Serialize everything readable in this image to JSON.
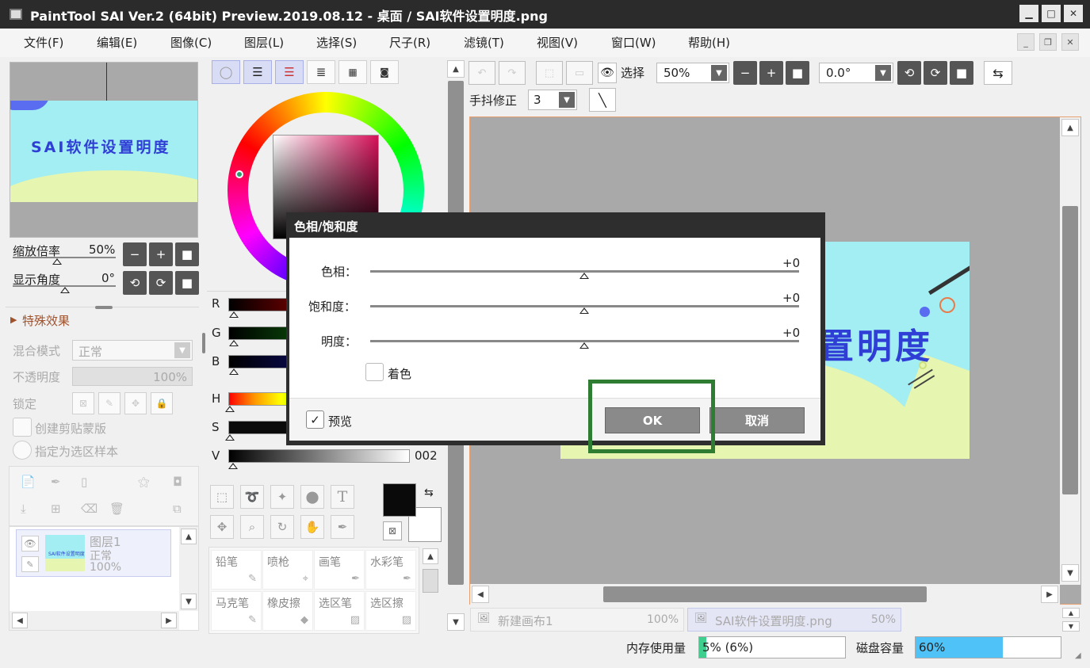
{
  "window": {
    "title": "PaintTool SAI Ver.2 (64bit) Preview.2019.08.12 - 桌面 / SAI软件设置明度.png"
  },
  "menu": [
    "文件(F)",
    "编辑(E)",
    "图像(C)",
    "图层(L)",
    "选择(S)",
    "尺子(R)",
    "滤镜(T)",
    "视图(V)",
    "窗口(W)",
    "帮助(H)"
  ],
  "navigator": {
    "preview_text": "SAI软件设置明度",
    "zoom_label": "缩放倍率",
    "zoom_value": "50%",
    "angle_label": "显示角度",
    "angle_value": "0°"
  },
  "layer_panel": {
    "effects_label": "特殊效果",
    "blend_label": "混合模式",
    "blend_value": "正常",
    "opacity_label": "不透明度",
    "opacity_value": "100%",
    "lock_label": "锁定",
    "clip_label": "创建剪贴蒙版",
    "sample_label": "指定为选区样本",
    "layer": {
      "name": "图层1",
      "mode": "正常",
      "opacity": "100%",
      "thumb_text": "SAI软件设置明度"
    }
  },
  "color_panel": {
    "sliders": {
      "r": "R",
      "g": "G",
      "b": "B",
      "h": "H",
      "s": "S",
      "v": "V"
    },
    "v_value": "002"
  },
  "tools_panel": {
    "text_tool_glyph": "T"
  },
  "brushes": [
    {
      "name": "铅笔"
    },
    {
      "name": "喷枪"
    },
    {
      "name": "画笔"
    },
    {
      "name": "水彩笔"
    },
    {
      "name": "马克笔"
    },
    {
      "name": "橡皮擦"
    },
    {
      "name": "选区笔"
    },
    {
      "name": "选区擦"
    }
  ],
  "toolbar": {
    "select_label": "选择",
    "zoom_value": "50%",
    "angle_value": "0.0°",
    "stabilizer_label": "手抖修正",
    "stabilizer_value": "3"
  },
  "canvas": {
    "art_text": "置明度"
  },
  "tabs": [
    {
      "name": "新建画布1",
      "zoom": "100%"
    },
    {
      "name": "SAI软件设置明度.png",
      "zoom": "50%"
    }
  ],
  "status": {
    "memory_label": "内存使用量",
    "memory_value": "5% (6%)",
    "memory_level": 0.05,
    "disk_label": "磁盘容量",
    "disk_value": "60%",
    "disk_level": 0.6
  },
  "dialog": {
    "title": "色相/饱和度",
    "hue_label": "色相：",
    "hue_value": "+0",
    "sat_label": "饱和度：",
    "sat_value": "+0",
    "light_label": "明度：",
    "light_value": "+0",
    "colorize_label": "着色",
    "preview_label": "预览",
    "ok_label": "OK",
    "cancel_label": "取消"
  },
  "colors": {
    "highlight_box": "#2e7d32",
    "canvas_bg": "#a9a9a9",
    "art_cyan": "#a3eef2",
    "art_yellow": "#e6f5b0",
    "art_text": "#2f3fd6",
    "memory_bar": "#3ecf8e",
    "disk_bar": "#4fc3f7"
  }
}
